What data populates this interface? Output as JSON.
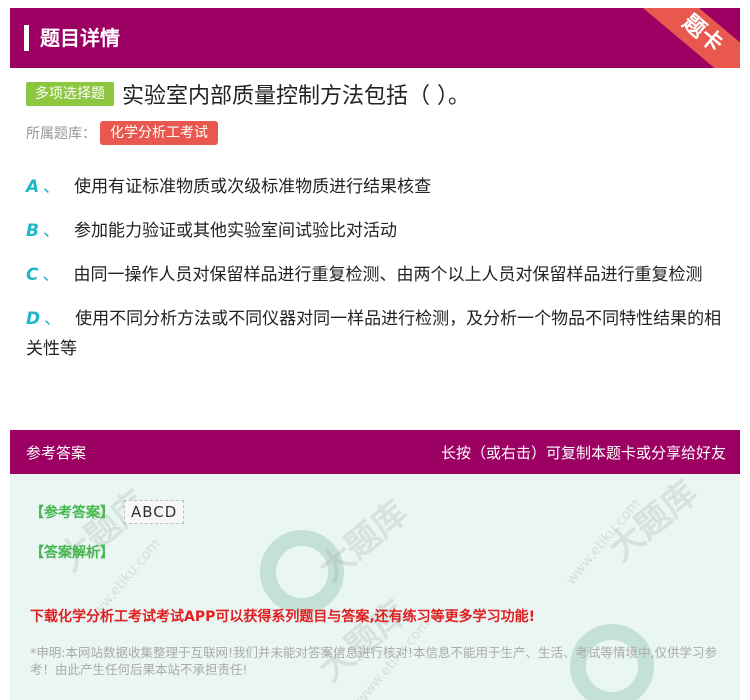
{
  "header": {
    "title": "题目详情",
    "ribbon": "题卡"
  },
  "question": {
    "type_badge": "多项选择题",
    "text": "实验室内部质量控制方法包括（ ）。",
    "library_label": "所属题库：",
    "library_name": "化学分析工考试"
  },
  "options": [
    {
      "letter": "A",
      "sep": "、",
      "text": "使用有证标准物质或次级标准物质进行结果核查"
    },
    {
      "letter": "B",
      "sep": "、",
      "text": "参加能力验证或其他实验室间试验比对活动"
    },
    {
      "letter": "C",
      "sep": "、",
      "text": "由同一操作人员对保留样品进行重复检测、由两个以上人员对保留样品进行重复检测"
    },
    {
      "letter": "D",
      "sep": "、",
      "text": "使用不同分析方法或不同仪器对同一样品进行检测，及分析一个物品不同特性结果的相关性等"
    }
  ],
  "answer_panel": {
    "header_left": "参考答案",
    "header_right": "长按（或右击）可复制本题卡或分享给好友",
    "answer_label": "【参考答案】",
    "answer_value": "ABCD",
    "analysis_label": "【答案解析】",
    "promo": "下载化学分析工考试考试APP可以获得系列题目与答案,还有练习等更多学习功能!",
    "disclaimer": "*申明:本网站数据收集整理于互联网!我们并未能对答案信息进行核对!本信息不能用于生产、生活、考试等情境中,仅供学习参考！由此产生任何后果本站不承担责任!"
  },
  "watermark": {
    "text": "大题库",
    "url": "www.etiku.com"
  },
  "colors": {
    "brand": "#9c0063",
    "accent_red": "#e8584e",
    "badge_green": "#8dc63f",
    "option_letter": "#1fb6c6",
    "answer_green": "#45b74e"
  }
}
